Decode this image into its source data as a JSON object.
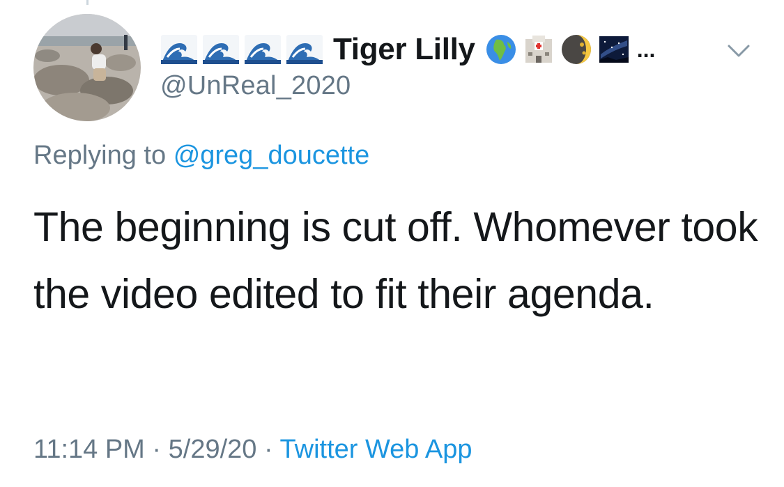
{
  "author": {
    "display_name": "Tiger Lilly",
    "handle": "@UnReal_2020",
    "name_prefix_icons": [
      "water-wave-icon",
      "water-wave-icon",
      "water-wave-icon",
      "water-wave-icon"
    ],
    "name_suffix_icons": [
      "globe-africa-icon",
      "hospital-icon",
      "moon-icon",
      "milky-way-icon"
    ],
    "truncation": "..."
  },
  "reply": {
    "prefix": "Replying to",
    "mention": "@greg_doucette"
  },
  "tweet": {
    "text": "The beginning is cut off. Whomever took the video edited to fit their agenda."
  },
  "meta": {
    "time": "11:14 PM",
    "separator": "·",
    "date": "5/29/20",
    "source": "Twitter Web App"
  },
  "colors": {
    "text": "#14171a",
    "secondary": "#657786",
    "link": "#1b95e0"
  }
}
